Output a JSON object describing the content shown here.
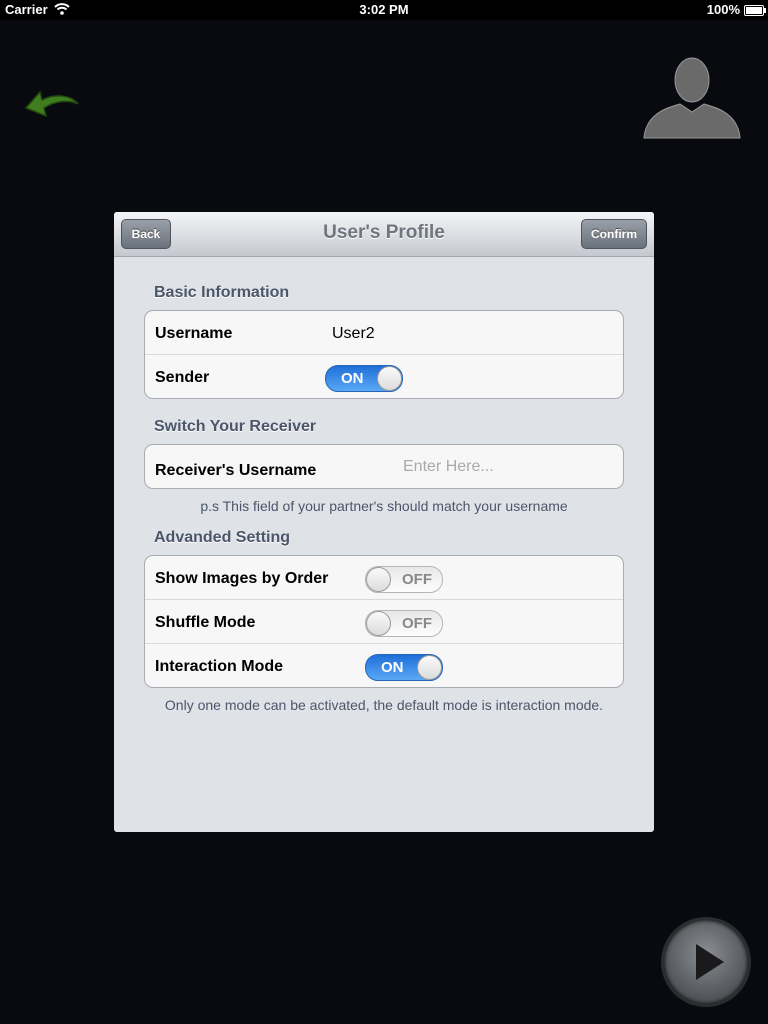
{
  "status_bar": {
    "carrier": "Carrier",
    "time": "3:02 PM",
    "battery": "100%"
  },
  "icons": {
    "back": "curved-back-arrow-icon",
    "avatar": "user-silhouette-icon",
    "play": "play-icon",
    "accent": "#2f7a1a"
  },
  "dialog": {
    "title": "User's Profile",
    "back_label": "Back",
    "confirm_label": "Confirm",
    "basic": {
      "header": "Basic Information",
      "username_label": "Username",
      "username_value": "User2",
      "sender_label": "Sender",
      "sender_toggle": "ON"
    },
    "receiver": {
      "header": "Switch Your Receiver",
      "label": "Receiver's Username",
      "placeholder": "Enter Here...",
      "note": "p.s This field of your partner's should match your username"
    },
    "advanced": {
      "header": "Advanded Setting",
      "rows": [
        {
          "label": "Show Images by Order",
          "toggle": "OFF"
        },
        {
          "label": "Shuffle Mode",
          "toggle": "OFF"
        },
        {
          "label": "Interaction Mode",
          "toggle": "ON"
        }
      ],
      "note": "Only one mode can be activated, the default mode is interaction mode."
    }
  }
}
